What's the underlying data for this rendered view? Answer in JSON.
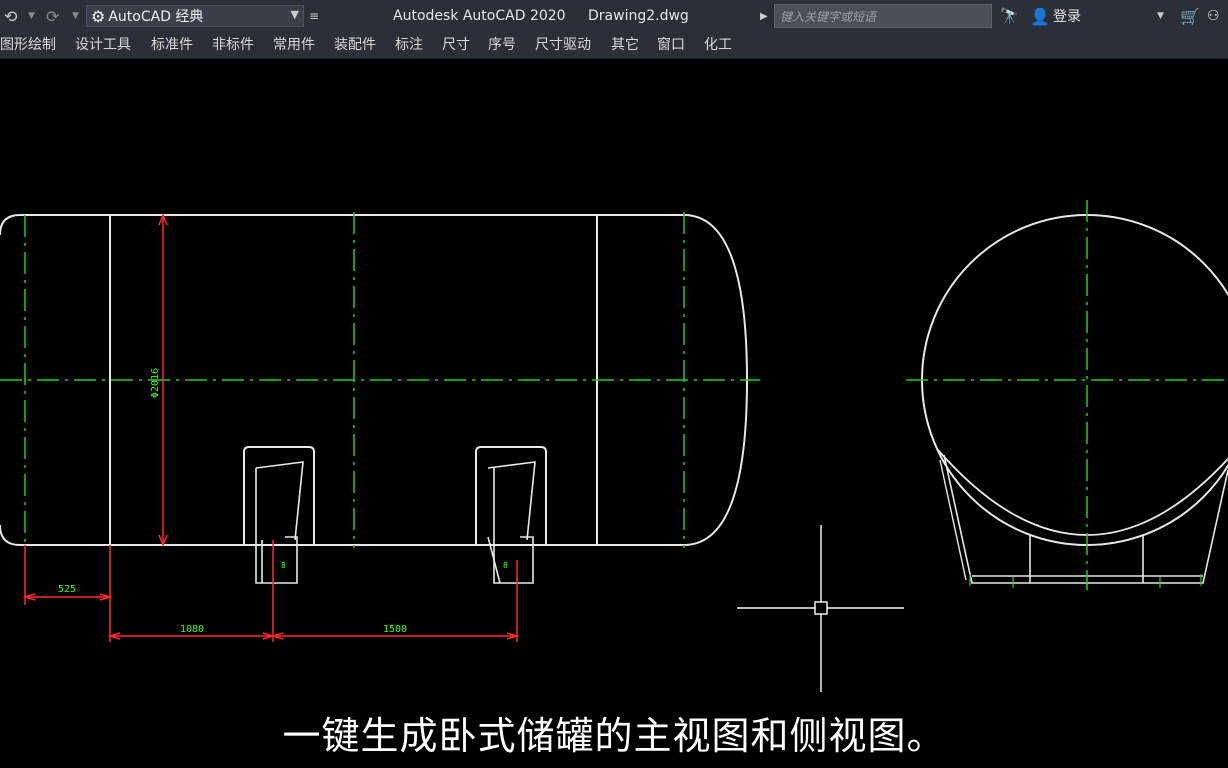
{
  "titlebar": {
    "workspace": "AutoCAD 经典",
    "app_title": "Autodesk AutoCAD 2020",
    "doc_title": "Drawing2.dwg",
    "search_placeholder": "键入关键字或短语",
    "login": "登录"
  },
  "menu": [
    "图形绘制",
    "设计工具",
    "标准件",
    "非标件",
    "常用件",
    "装配件",
    "标注",
    "尺寸",
    "序号",
    "尺寸驱动",
    "其它",
    "窗口",
    "化工"
  ],
  "drawing": {
    "dim_diameter": "Φ2016",
    "dim_525": "525",
    "dim_1080": "1080",
    "dim_1500": "1500",
    "mark_left": "8",
    "mark_right": "8"
  },
  "colors": {
    "line": "#e8e8e8",
    "centerline": "#1fd01f",
    "dimension": "#ff2a2a",
    "dim_text": "#33ff33"
  },
  "subtitle": "一键生成卧式储罐的主视图和侧视图。"
}
